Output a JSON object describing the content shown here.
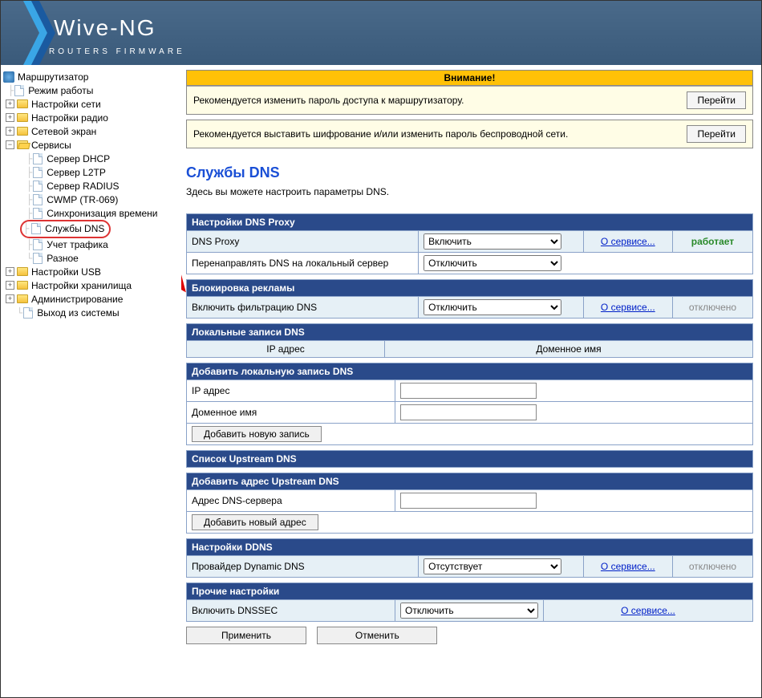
{
  "logo": {
    "main": "Wive-NG",
    "sub": "ROUTERS FIRMWARE"
  },
  "tree": {
    "root": "Маршрутизатор",
    "mode": "Режим работы",
    "net": "Настройки сети",
    "radio": "Настройки радио",
    "fw": "Сетевой экран",
    "services": "Сервисы",
    "svc_dhcp": "Сервер DHCP",
    "svc_l2tp": "Сервер L2TP",
    "svc_radius": "Сервер RADIUS",
    "svc_cwmp": "CWMP (TR-069)",
    "svc_time": "Синхронизация времени",
    "svc_dns": "Службы DNS",
    "svc_traffic": "Учет трафика",
    "svc_misc": "Разное",
    "usb": "Настройки USB",
    "storage": "Настройки хранилища",
    "admin": "Администрирование",
    "logout": "Выход из системы"
  },
  "notice": {
    "title": "Внимание!",
    "msg1": "Рекомендуется изменить пароль доступа к маршрутизатору.",
    "msg2": "Рекомендуется выставить шифрование и/или изменить пароль беспроводной сети.",
    "goto": "Перейти"
  },
  "page": {
    "title": "Службы DNS",
    "desc": "Здесь вы можете настроить параметры DNS."
  },
  "opt": {
    "enable": "Включить",
    "disable": "Отключить",
    "none": "Отсутствует"
  },
  "link": {
    "about": "О сервисе..."
  },
  "status": {
    "on": "работает",
    "off": "отключено"
  },
  "s1": {
    "hdr": "Настройки DNS Proxy",
    "r1": "DNS Proxy",
    "r2": "Перенаправлять DNS на локальный сервер"
  },
  "s2": {
    "hdr": "Блокировка рекламы",
    "r1": "Включить фильтрацию DNS"
  },
  "s3": {
    "hdr": "Локальные записи DNS",
    "c1": "IP адрес",
    "c2": "Доменное имя"
  },
  "s4": {
    "hdr": "Добавить локальную запись DNS",
    "r1": "IP адрес",
    "r2": "Доменное имя",
    "btn": "Добавить новую запись"
  },
  "s5": {
    "hdr": "Список Upstream DNS"
  },
  "s6": {
    "hdr": "Добавить адрес Upstream DNS",
    "r1": "Адрес DNS-сервера",
    "btn": "Добавить новый адрес"
  },
  "s7": {
    "hdr": "Настройки DDNS",
    "r1": "Провайдер Dynamic DNS"
  },
  "s8": {
    "hdr": "Прочие настройки",
    "r1": "Включить DNSSEC"
  },
  "actions": {
    "apply": "Применить",
    "cancel": "Отменить"
  }
}
